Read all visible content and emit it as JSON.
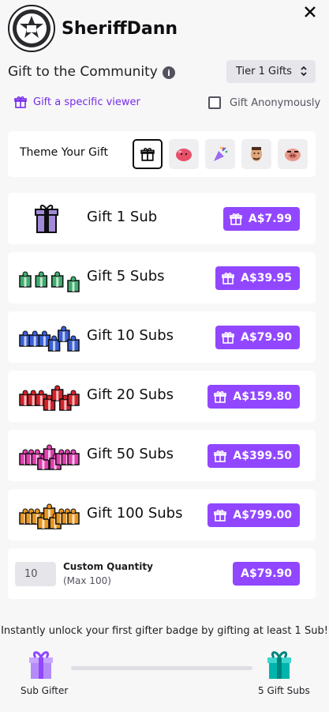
{
  "header": {
    "channel_name": "SheriffDann",
    "avatar_icon": "sheriff-badge-avatar",
    "close_icon": "close-icon"
  },
  "title_row": {
    "title": "Gift to the Community",
    "info_icon": "info-icon",
    "tier_select": {
      "selected": "Tier 1 Gifts"
    }
  },
  "options": {
    "gift_viewer_label": "Gift a specific viewer",
    "gift_anonymously_label": "Gift Anonymously",
    "gift_anonymously_checked": false
  },
  "theme": {
    "label": "Theme Your Gift",
    "options": [
      {
        "icon": "gift-icon",
        "selected": true
      },
      {
        "icon": "heart-emote-icon",
        "selected": false
      },
      {
        "icon": "party-popper-icon",
        "selected": false
      },
      {
        "icon": "face-emote-icon",
        "selected": false
      },
      {
        "icon": "pig-emote-icon",
        "selected": false
      }
    ]
  },
  "gift_options": [
    {
      "label": "Gift 1 Sub",
      "price": "A$7.99",
      "color": "#a18bd9",
      "count": 1
    },
    {
      "label": "Gift 5 Subs",
      "price": "A$39.95",
      "color": "#3fae6f",
      "count": 5
    },
    {
      "label": "Gift 10 Subs",
      "price": "A$79.90",
      "color": "#3a5fd6",
      "count": 10
    },
    {
      "label": "Gift 20 Subs",
      "price": "A$159.80",
      "color": "#d6232a",
      "count": 20
    },
    {
      "label": "Gift 50 Subs",
      "price": "A$399.50",
      "color": "#e23fb0",
      "count": 50
    },
    {
      "label": "Gift 100 Subs",
      "price": "A$799.00",
      "color": "#e8961e",
      "count": 100
    }
  ],
  "custom": {
    "quantity_value": "10",
    "label": "Custom Quantity",
    "max_note": "(Max 100)",
    "price": "A$79.90"
  },
  "badge_progress": {
    "message": "Instantly unlock your first gifter badge by gifting at least 1 Sub!",
    "start_label": "Sub Gifter",
    "end_label": "5 Gift Subs",
    "start_color": "#9147ff",
    "end_color": "#00b5ad",
    "progress_fraction": 0
  },
  "colors": {
    "accent": "#9147ff",
    "link": "#772ce8",
    "card_bg": "#ffffff",
    "page_bg": "#f7f7f8"
  }
}
